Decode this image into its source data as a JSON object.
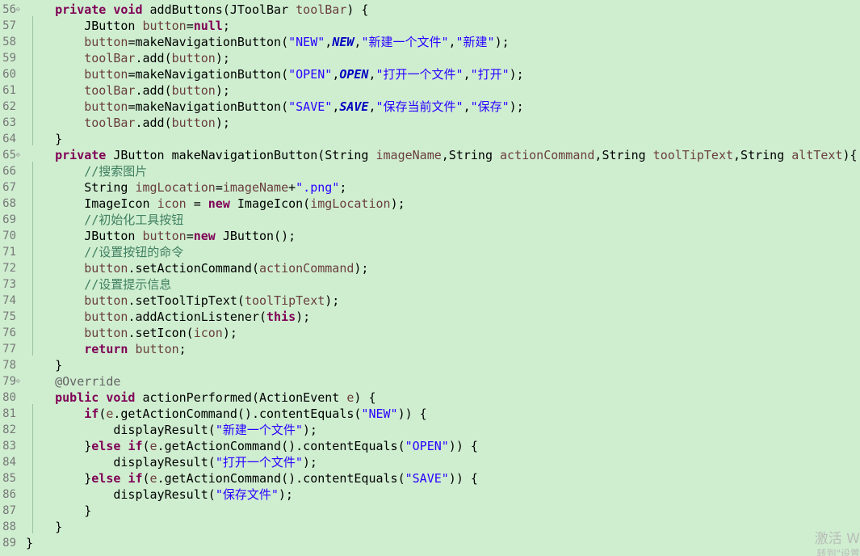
{
  "lines": [
    {
      "n": "56",
      "fold": "⊖"
    },
    {
      "n": "57"
    },
    {
      "n": "58"
    },
    {
      "n": "59"
    },
    {
      "n": "60"
    },
    {
      "n": "61"
    },
    {
      "n": "62"
    },
    {
      "n": "63"
    },
    {
      "n": "64"
    },
    {
      "n": "65",
      "fold": "⊖"
    },
    {
      "n": "66"
    },
    {
      "n": "67"
    },
    {
      "n": "68"
    },
    {
      "n": "69"
    },
    {
      "n": "70"
    },
    {
      "n": "71"
    },
    {
      "n": "72"
    },
    {
      "n": "73"
    },
    {
      "n": "74"
    },
    {
      "n": "75"
    },
    {
      "n": "76"
    },
    {
      "n": "77"
    },
    {
      "n": "78"
    },
    {
      "n": "79",
      "fold": "⊖"
    },
    {
      "n": "80"
    },
    {
      "n": "81"
    },
    {
      "n": "82"
    },
    {
      "n": "83"
    },
    {
      "n": "84"
    },
    {
      "n": "85"
    },
    {
      "n": "86"
    },
    {
      "n": "87"
    },
    {
      "n": "88"
    },
    {
      "n": "89"
    }
  ],
  "code": {
    "l56": {
      "kw1": "private",
      "kw2": "void",
      "rest": " addButtons(JToolBar ",
      "var": "toolBar",
      "end": ") {"
    },
    "l57": {
      "t1": "JButton ",
      "var": "button",
      "t2": "=",
      "kw": "null",
      "t3": ";"
    },
    "l58": {
      "var": "button",
      "t1": "=makeNavigationButton(",
      "s1": "\"NEW\"",
      "t2": ",",
      "f": "NEW",
      "t3": ",",
      "s2": "\"新建一个文件\"",
      "t4": ",",
      "s3": "\"新建\"",
      "t5": ");"
    },
    "l59": {
      "var": "toolBar",
      "t1": ".add(",
      "var2": "button",
      "t2": ");"
    },
    "l60": {
      "var": "button",
      "t1": "=makeNavigationButton(",
      "s1": "\"OPEN\"",
      "t2": ",",
      "f": "OPEN",
      "t3": ",",
      "s2": "\"打开一个文件\"",
      "t4": ",",
      "s3": "\"打开\"",
      "t5": ");"
    },
    "l61": {
      "var": "toolBar",
      "t1": ".add(",
      "var2": "button",
      "t2": ");"
    },
    "l62": {
      "var": "button",
      "t1": "=makeNavigationButton(",
      "s1": "\"SAVE\"",
      "t2": ",",
      "f": "SAVE",
      "t3": ",",
      "s2": "\"保存当前文件\"",
      "t4": ",",
      "s3": "\"保存\"",
      "t5": ");"
    },
    "l63": {
      "var": "toolBar",
      "t1": ".add(",
      "var2": "button",
      "t2": ");"
    },
    "l64": {
      "t1": "}"
    },
    "l65": {
      "kw1": "private",
      "t1": " JButton makeNavigationButton(String ",
      "v1": "imageName",
      "t2": ",String ",
      "v2": "actionCommand",
      "t3": ",String ",
      "v3": "toolTipText",
      "t4": ",String ",
      "v4": "altText",
      "t5": "){"
    },
    "l66": {
      "c": "//搜索图片"
    },
    "l67": {
      "t1": "String ",
      "var": "imgLocation",
      "t2": "=",
      "var2": "imageName",
      "t3": "+",
      "s": "\".png\"",
      "t4": ";"
    },
    "l68": {
      "t1": "ImageIcon ",
      "var": "icon",
      "t2": " = ",
      "kw": "new",
      "t3": " ImageIcon(",
      "var2": "imgLocation",
      "t4": ");"
    },
    "l69": {
      "c": "//初始化工具按钮"
    },
    "l70": {
      "t1": "JButton ",
      "var": "button",
      "t2": "=",
      "kw": "new",
      "t3": " JButton();"
    },
    "l71": {
      "c": "//设置按钮的命令"
    },
    "l72": {
      "var": "button",
      "t1": ".setActionCommand(",
      "var2": "actionCommand",
      "t2": ");"
    },
    "l73": {
      "c": "//设置提示信息"
    },
    "l74": {
      "var": "button",
      "t1": ".setToolTipText(",
      "var2": "toolTipText",
      "t2": ");"
    },
    "l75": {
      "var": "button",
      "t1": ".addActionListener(",
      "kw": "this",
      "t2": ");"
    },
    "l76": {
      "var": "button",
      "t1": ".setIcon(",
      "var2": "icon",
      "t2": ");"
    },
    "l77": {
      "kw": "return",
      "t1": " ",
      "var": "button",
      "t2": ";"
    },
    "l78": {
      "t1": "}"
    },
    "l79": {
      "a": "@Override"
    },
    "l80": {
      "kw1": "public",
      "kw2": "void",
      "t1": " actionPerformed(ActionEvent ",
      "var": "e",
      "t2": ") {"
    },
    "l81": {
      "kw": "if",
      "t1": "(",
      "var": "e",
      "t2": ".getActionCommand().contentEquals(",
      "s": "\"NEW\"",
      "t3": ")) {"
    },
    "l82": {
      "t1": "displayResult(",
      "s": "\"新建一个文件\"",
      "t2": ");"
    },
    "l83": {
      "t1": "}",
      "kw1": "else",
      "t2": " ",
      "kw2": "if",
      "t3": "(",
      "var": "e",
      "t4": ".getActionCommand().contentEquals(",
      "s": "\"OPEN\"",
      "t5": ")) {"
    },
    "l84": {
      "t1": "displayResult(",
      "s": "\"打开一个文件\"",
      "t2": ");"
    },
    "l85": {
      "t1": "}",
      "kw1": "else",
      "t2": " ",
      "kw2": "if",
      "t3": "(",
      "var": "e",
      "t4": ".getActionCommand().contentEquals(",
      "s": "\"SAVE\"",
      "t5": ")) {"
    },
    "l86": {
      "t1": "displayResult(",
      "s": "\"保存文件\"",
      "t2": ");"
    },
    "l87": {
      "t1": "}"
    },
    "l88": {
      "t1": "}"
    },
    "l89": {
      "t1": "}"
    }
  },
  "watermark": {
    "line1": "激活 W",
    "line2": "转到\"设置"
  },
  "colors": {
    "background": "#cfeed0",
    "keyword": "#7f0055",
    "string": "#2a00ff",
    "static_field": "#0000c0",
    "variable": "#6a3e3e",
    "comment": "#3f7f5f",
    "annotation": "#646464",
    "line_number": "#787878"
  }
}
